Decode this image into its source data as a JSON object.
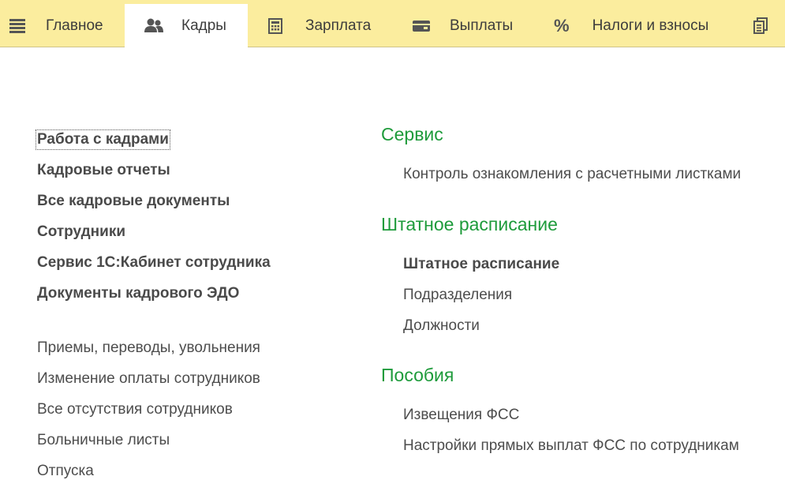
{
  "topbar": {
    "menu_icon": "hamburger-menu-icon",
    "tabs": [
      {
        "label": "Главное",
        "icon": "none"
      },
      {
        "label": "Кадры",
        "icon": "people-icon",
        "active": true
      },
      {
        "label": "Зарплата",
        "icon": "calculator-icon"
      },
      {
        "label": "Выплаты",
        "icon": "wallet-icon"
      },
      {
        "label": "Налоги и взносы",
        "icon": "percent-icon"
      }
    ],
    "more_icon": "copy-documents-icon"
  },
  "left_column": {
    "primary": [
      {
        "label": "Работа с кадрами",
        "focused": true
      },
      {
        "label": "Кадровые отчеты"
      },
      {
        "label": "Все кадровые документы"
      },
      {
        "label": "Сотрудники"
      },
      {
        "label": "Сервис 1С:Кабинет сотрудника"
      },
      {
        "label": "Документы кадрового ЭДО"
      }
    ],
    "secondary": [
      {
        "label": "Приемы, переводы, увольнения"
      },
      {
        "label": "Изменение оплаты сотрудников"
      },
      {
        "label": "Все отсутствия сотрудников"
      },
      {
        "label": "Больничные листы"
      },
      {
        "label": "Отпуска"
      }
    ]
  },
  "right_column": {
    "groups": [
      {
        "title": "Сервис",
        "items": [
          {
            "label": "Контроль ознакомления с расчетными листками"
          }
        ]
      },
      {
        "title": "Штатное расписание",
        "items": [
          {
            "label": "Штатное расписание",
            "bold": true
          },
          {
            "label": "Подразделения"
          },
          {
            "label": "Должности"
          }
        ]
      },
      {
        "title": "Пособия",
        "items": [
          {
            "label": "Извещения ФСС"
          },
          {
            "label": "Настройки прямых выплат ФСС по сотрудникам"
          }
        ]
      }
    ]
  },
  "colors": {
    "topbar_bg": "#fbed9e",
    "group_title": "#1e9b3b",
    "text": "#4d4d4d"
  }
}
